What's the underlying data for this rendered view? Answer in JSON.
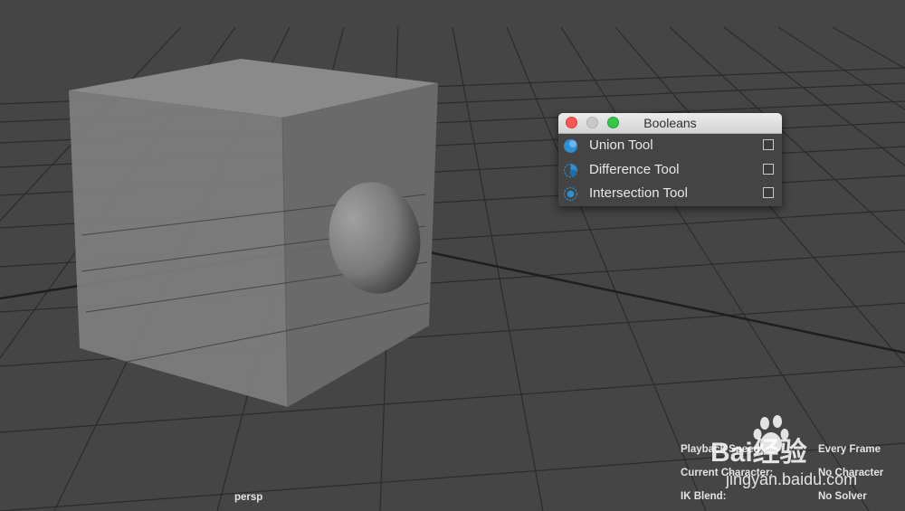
{
  "booleans_window": {
    "title": "Booleans",
    "tools": [
      {
        "label": "Union Tool",
        "icon": "union-icon",
        "checked": false
      },
      {
        "label": "Difference Tool",
        "icon": "difference-icon",
        "checked": false
      },
      {
        "label": "Intersection Tool",
        "icon": "intersection-icon",
        "checked": false
      }
    ]
  },
  "viewport": {
    "camera_label": "persp",
    "hud": {
      "playback_speed_label": "Playback Speed:",
      "playback_speed_value": "Every Frame",
      "current_character_label": "Current Character:",
      "current_character_value": "No Character",
      "ik_blend_label": "IK Blend:",
      "ik_blend_value": "No Solver"
    }
  },
  "watermark": {
    "brand_glyphs": "Bai经验",
    "url": "jingyan.baidu.com"
  },
  "colors": {
    "background": "#454545",
    "grid": "#2a2a2a",
    "cube": "#7d7d7d",
    "icon_blue": "#2f8fd6"
  }
}
